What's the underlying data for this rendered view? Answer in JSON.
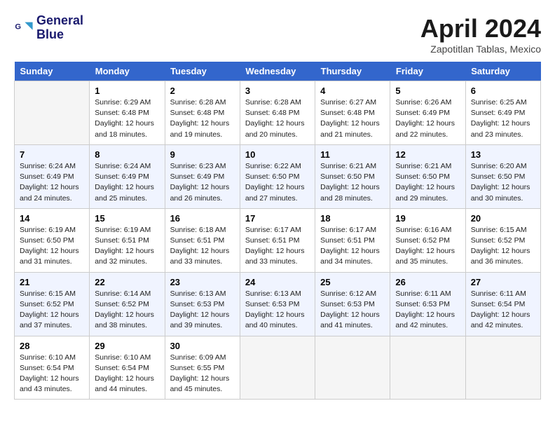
{
  "header": {
    "logo_line1": "General",
    "logo_line2": "Blue",
    "month": "April 2024",
    "location": "Zapotitlan Tablas, Mexico"
  },
  "days_of_week": [
    "Sunday",
    "Monday",
    "Tuesday",
    "Wednesday",
    "Thursday",
    "Friday",
    "Saturday"
  ],
  "weeks": [
    [
      {
        "day": "",
        "info": ""
      },
      {
        "day": "1",
        "info": "Sunrise: 6:29 AM\nSunset: 6:48 PM\nDaylight: 12 hours\nand 18 minutes."
      },
      {
        "day": "2",
        "info": "Sunrise: 6:28 AM\nSunset: 6:48 PM\nDaylight: 12 hours\nand 19 minutes."
      },
      {
        "day": "3",
        "info": "Sunrise: 6:28 AM\nSunset: 6:48 PM\nDaylight: 12 hours\nand 20 minutes."
      },
      {
        "day": "4",
        "info": "Sunrise: 6:27 AM\nSunset: 6:48 PM\nDaylight: 12 hours\nand 21 minutes."
      },
      {
        "day": "5",
        "info": "Sunrise: 6:26 AM\nSunset: 6:49 PM\nDaylight: 12 hours\nand 22 minutes."
      },
      {
        "day": "6",
        "info": "Sunrise: 6:25 AM\nSunset: 6:49 PM\nDaylight: 12 hours\nand 23 minutes."
      }
    ],
    [
      {
        "day": "7",
        "info": "Sunrise: 6:24 AM\nSunset: 6:49 PM\nDaylight: 12 hours\nand 24 minutes."
      },
      {
        "day": "8",
        "info": "Sunrise: 6:24 AM\nSunset: 6:49 PM\nDaylight: 12 hours\nand 25 minutes."
      },
      {
        "day": "9",
        "info": "Sunrise: 6:23 AM\nSunset: 6:49 PM\nDaylight: 12 hours\nand 26 minutes."
      },
      {
        "day": "10",
        "info": "Sunrise: 6:22 AM\nSunset: 6:50 PM\nDaylight: 12 hours\nand 27 minutes."
      },
      {
        "day": "11",
        "info": "Sunrise: 6:21 AM\nSunset: 6:50 PM\nDaylight: 12 hours\nand 28 minutes."
      },
      {
        "day": "12",
        "info": "Sunrise: 6:21 AM\nSunset: 6:50 PM\nDaylight: 12 hours\nand 29 minutes."
      },
      {
        "day": "13",
        "info": "Sunrise: 6:20 AM\nSunset: 6:50 PM\nDaylight: 12 hours\nand 30 minutes."
      }
    ],
    [
      {
        "day": "14",
        "info": "Sunrise: 6:19 AM\nSunset: 6:50 PM\nDaylight: 12 hours\nand 31 minutes."
      },
      {
        "day": "15",
        "info": "Sunrise: 6:19 AM\nSunset: 6:51 PM\nDaylight: 12 hours\nand 32 minutes."
      },
      {
        "day": "16",
        "info": "Sunrise: 6:18 AM\nSunset: 6:51 PM\nDaylight: 12 hours\nand 33 minutes."
      },
      {
        "day": "17",
        "info": "Sunrise: 6:17 AM\nSunset: 6:51 PM\nDaylight: 12 hours\nand 33 minutes."
      },
      {
        "day": "18",
        "info": "Sunrise: 6:17 AM\nSunset: 6:51 PM\nDaylight: 12 hours\nand 34 minutes."
      },
      {
        "day": "19",
        "info": "Sunrise: 6:16 AM\nSunset: 6:52 PM\nDaylight: 12 hours\nand 35 minutes."
      },
      {
        "day": "20",
        "info": "Sunrise: 6:15 AM\nSunset: 6:52 PM\nDaylight: 12 hours\nand 36 minutes."
      }
    ],
    [
      {
        "day": "21",
        "info": "Sunrise: 6:15 AM\nSunset: 6:52 PM\nDaylight: 12 hours\nand 37 minutes."
      },
      {
        "day": "22",
        "info": "Sunrise: 6:14 AM\nSunset: 6:52 PM\nDaylight: 12 hours\nand 38 minutes."
      },
      {
        "day": "23",
        "info": "Sunrise: 6:13 AM\nSunset: 6:53 PM\nDaylight: 12 hours\nand 39 minutes."
      },
      {
        "day": "24",
        "info": "Sunrise: 6:13 AM\nSunset: 6:53 PM\nDaylight: 12 hours\nand 40 minutes."
      },
      {
        "day": "25",
        "info": "Sunrise: 6:12 AM\nSunset: 6:53 PM\nDaylight: 12 hours\nand 41 minutes."
      },
      {
        "day": "26",
        "info": "Sunrise: 6:11 AM\nSunset: 6:53 PM\nDaylight: 12 hours\nand 42 minutes."
      },
      {
        "day": "27",
        "info": "Sunrise: 6:11 AM\nSunset: 6:54 PM\nDaylight: 12 hours\nand 42 minutes."
      }
    ],
    [
      {
        "day": "28",
        "info": "Sunrise: 6:10 AM\nSunset: 6:54 PM\nDaylight: 12 hours\nand 43 minutes."
      },
      {
        "day": "29",
        "info": "Sunrise: 6:10 AM\nSunset: 6:54 PM\nDaylight: 12 hours\nand 44 minutes."
      },
      {
        "day": "30",
        "info": "Sunrise: 6:09 AM\nSunset: 6:55 PM\nDaylight: 12 hours\nand 45 minutes."
      },
      {
        "day": "",
        "info": ""
      },
      {
        "day": "",
        "info": ""
      },
      {
        "day": "",
        "info": ""
      },
      {
        "day": "",
        "info": ""
      }
    ]
  ]
}
